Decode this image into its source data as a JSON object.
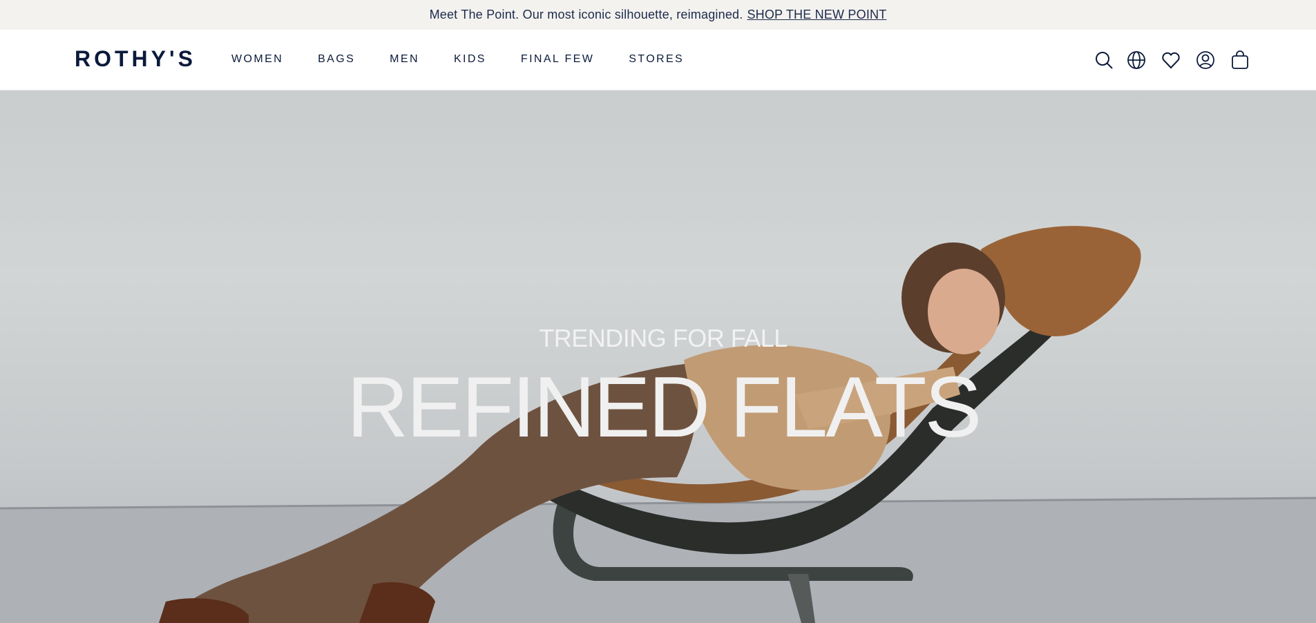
{
  "announcement": {
    "text": "Meet The Point. Our most iconic silhouette, reimagined.",
    "link": "SHOP THE NEW POINT"
  },
  "header": {
    "logo": "ROTHY'S",
    "nav": [
      "WOMEN",
      "BAGS",
      "MEN",
      "KIDS",
      "FINAL FEW",
      "STORES"
    ],
    "icons": [
      "search-icon",
      "globe-icon",
      "heart-icon",
      "account-icon",
      "bag-icon"
    ]
  },
  "hero": {
    "kicker": "TRENDING FOR FALL",
    "title": "REFINED FLATS"
  },
  "colors": {
    "navy": "#0b1a3b",
    "announce_bg": "#f3f2ef",
    "hero_bg": "#cdd0d1"
  }
}
